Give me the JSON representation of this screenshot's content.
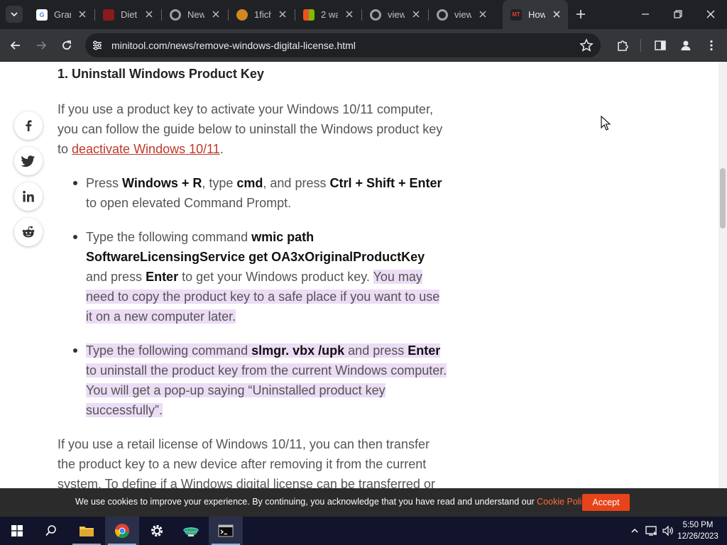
{
  "browser": {
    "tabs": [
      {
        "title": "Gran",
        "favicon": "google-icon",
        "color": "#ffffff"
      },
      {
        "title": "Diet",
        "favicon": "red-site-icon",
        "color": "#8b1a1a"
      },
      {
        "title": "New",
        "favicon": "chrome-icon",
        "color": "#9aa0a6"
      },
      {
        "title": "1fich",
        "favicon": "pizza-icon",
        "color": "#d2871f"
      },
      {
        "title": "2 wa",
        "favicon": "windows-icon",
        "color": "#4285f4"
      },
      {
        "title": "view",
        "favicon": "chrome-icon",
        "color": "#9aa0a6"
      },
      {
        "title": "view",
        "favicon": "chrome-icon",
        "color": "#9aa0a6"
      },
      {
        "title": "How",
        "favicon": "minitool-icon",
        "color": "#c0392b"
      }
    ],
    "active_tab_favicon_text": "MT",
    "url": "minitool.com/news/remove-windows-digital-license.html"
  },
  "article": {
    "heading": "1. Uninstall Windows Product Key",
    "intro_pre": "If you use a product key to activate your Windows 10/11 computer, you can follow the guide below to uninstall the Windows product key to ",
    "intro_link": "deactivate Windows 10/11",
    "intro_post": ".",
    "bullet1": {
      "t1": "Press ",
      "b1": "Windows + R",
      "t2": ", type ",
      "b2": "cmd",
      "t3": ", and press ",
      "b3": "Ctrl + Shift + Enter",
      "t4": " to open elevated Command Prompt."
    },
    "bullet2": {
      "t1": "Type the following command ",
      "b1": "wmic path SoftwareLicensingService get OA3xOriginalProductKey",
      "t2": " and press ",
      "b2": "Enter",
      "t3": " to get your Windows product key. ",
      "hl": "You may need to copy the product key to a safe place if you want to use it on a new computer later."
    },
    "bullet3": {
      "t1": "Type the following command ",
      "b1": "slmgr. vbx /upk",
      "t2": " and press ",
      "b2": "Enter",
      "t3": " to uninstall the product key from the current Windows computer. You will get a pop-up saying “Uninstalled product key successfully”."
    },
    "outro": "If you use a retail license of Windows 10/11, you can then transfer the product key to a new device after removing it from the current system. To define if a Windows digital license can be transferred or"
  },
  "cookie": {
    "text": "We use cookies to improve your experience. By continuing, you acknowledge that you have read and understand our ",
    "link": "Cookie Policy",
    "tail": ".",
    "accept": "Accept"
  },
  "taskbar": {
    "time": "5:50 PM",
    "date": "12/26/2023"
  },
  "colors": {
    "link": "#c0392b",
    "highlight": "#ecdcf5",
    "accept_button": "#e8431b",
    "cookie_link": "#ff6a3d"
  }
}
